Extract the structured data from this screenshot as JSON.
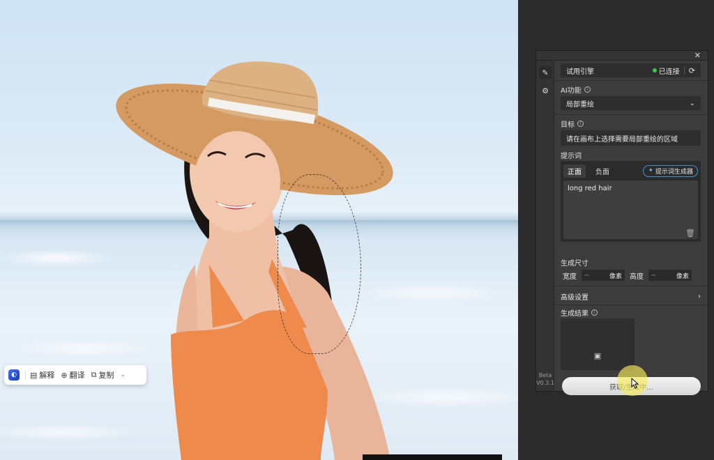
{
  "float_toolbar": {
    "explain_label": "解释",
    "translate_label": "翻译",
    "copy_label": "复制"
  },
  "panel": {
    "version_line1": "Beta",
    "version_line2": "V0.3.1",
    "engine": {
      "name": "试用引擎",
      "status": "已连接",
      "status_color": "#3dc94a"
    },
    "ai_function": {
      "label": "AI功能",
      "value": "局部重绘"
    },
    "target": {
      "label": "目标",
      "value": "请在画布上选择需要局部重绘的区域"
    },
    "prompt": {
      "label": "提示词",
      "tab_positive": "正面",
      "tab_negative": "负面",
      "generator_label": "提示词生成器",
      "text": "long red hair"
    },
    "size": {
      "label": "生成尺寸",
      "width_label": "宽度",
      "width_value": "--",
      "height_label": "高度",
      "height_value": "--",
      "unit": "像素"
    },
    "advanced_label": "高级设置",
    "result_label": "生成结果",
    "generate_button": "获取/生成中..."
  },
  "icons": {
    "close": "close-icon",
    "edit": "pencil-icon",
    "settings": "gear-icon",
    "refresh": "refresh-icon",
    "trash": "trash-icon",
    "image": "image-icon"
  }
}
